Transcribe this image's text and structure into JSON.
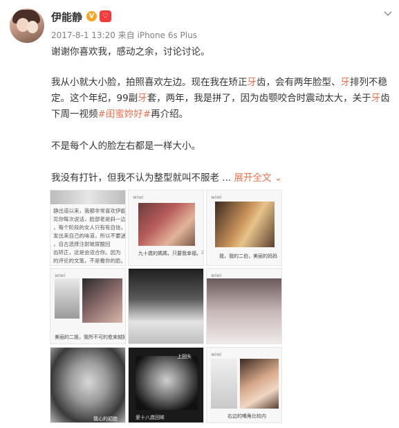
{
  "post": {
    "author": "伊能静",
    "badge_v": "V",
    "badge_vip": "㊙",
    "meta": "2017-8-1 13:20 来自 iPhone 6s Plus",
    "line1": "谢谢你喜欢我，感动之余，讨论讨论。",
    "p2_a": "我从小就大小脸，拍照喜欢左边。现在我在矫正",
    "p2_ya1": "牙",
    "p2_b": "齿，会有两年脸型、",
    "p2_ya2": "牙",
    "p2_c": "排列不稳定。这个年纪，99副",
    "p2_ya3": "牙",
    "p2_d": "套，两年，我是拼了，因为齿颚咬合时震动太大，关于",
    "p2_ya4": "牙",
    "p2_e": "齿下周一视频",
    "p2_tag": "#闺蜜妳好#",
    "p2_f": "再介绍。",
    "line3": "不是每个人的脸左右都是一样大小。",
    "line4": "我没有打针，但我不认为整型就叫不服老",
    "ellipsis": " ... ",
    "expand": "展开全文",
    "expand_icon": "chevron-down-icon"
  },
  "thumbs": {
    "t1_lines": [
      "静出道以来，我都非常喜欢伊能静",
      "见你每次说话，脸部老是斜一边，",
      "，每个阶段的女人只有有自信，",
      "发出来自己的味道，所以不要迷信",
      "，自古选择注射玻尿酸回",
      "齿矫正，这是会适合你。因为",
      "的评论的文笔，不是看你的脸。"
    ],
    "t2_caption": "九十歲的媽媽，只要我幸福，不上美容院，",
    "t2_label": "wiwi",
    "t3_caption": "我，我的二伯，美丽的妈妈",
    "t3_label": "wiwi",
    "t4_caption": "美丽的二姐，我所不可的愈来越好看",
    "t4_label": "wiwi",
    "t6_label": "wiwi",
    "t7_caption": "我心的初脸",
    "t8_caption": "爱十八歲回眸",
    "t8_corner": "上回头",
    "t9_caption": "右边的嘴角比较内",
    "t9_label": "wiwi"
  },
  "colors": {
    "accent": "#eb7350",
    "meta": "#808080",
    "text": "#333333"
  }
}
